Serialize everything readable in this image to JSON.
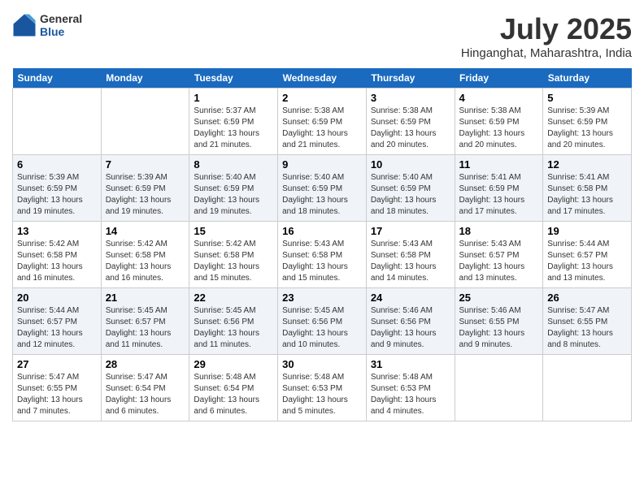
{
  "header": {
    "logo": {
      "general": "General",
      "blue": "Blue"
    },
    "title": "July 2025",
    "location": "Hinganghat, Maharashtra, India"
  },
  "calendar": {
    "headers": [
      "Sunday",
      "Monday",
      "Tuesday",
      "Wednesday",
      "Thursday",
      "Friday",
      "Saturday"
    ],
    "weeks": [
      [
        {
          "day": "",
          "info": ""
        },
        {
          "day": "",
          "info": ""
        },
        {
          "day": "1",
          "info": "Sunrise: 5:37 AM\nSunset: 6:59 PM\nDaylight: 13 hours and 21 minutes."
        },
        {
          "day": "2",
          "info": "Sunrise: 5:38 AM\nSunset: 6:59 PM\nDaylight: 13 hours and 21 minutes."
        },
        {
          "day": "3",
          "info": "Sunrise: 5:38 AM\nSunset: 6:59 PM\nDaylight: 13 hours and 20 minutes."
        },
        {
          "day": "4",
          "info": "Sunrise: 5:38 AM\nSunset: 6:59 PM\nDaylight: 13 hours and 20 minutes."
        },
        {
          "day": "5",
          "info": "Sunrise: 5:39 AM\nSunset: 6:59 PM\nDaylight: 13 hours and 20 minutes."
        }
      ],
      [
        {
          "day": "6",
          "info": "Sunrise: 5:39 AM\nSunset: 6:59 PM\nDaylight: 13 hours and 19 minutes."
        },
        {
          "day": "7",
          "info": "Sunrise: 5:39 AM\nSunset: 6:59 PM\nDaylight: 13 hours and 19 minutes."
        },
        {
          "day": "8",
          "info": "Sunrise: 5:40 AM\nSunset: 6:59 PM\nDaylight: 13 hours and 19 minutes."
        },
        {
          "day": "9",
          "info": "Sunrise: 5:40 AM\nSunset: 6:59 PM\nDaylight: 13 hours and 18 minutes."
        },
        {
          "day": "10",
          "info": "Sunrise: 5:40 AM\nSunset: 6:59 PM\nDaylight: 13 hours and 18 minutes."
        },
        {
          "day": "11",
          "info": "Sunrise: 5:41 AM\nSunset: 6:59 PM\nDaylight: 13 hours and 17 minutes."
        },
        {
          "day": "12",
          "info": "Sunrise: 5:41 AM\nSunset: 6:58 PM\nDaylight: 13 hours and 17 minutes."
        }
      ],
      [
        {
          "day": "13",
          "info": "Sunrise: 5:42 AM\nSunset: 6:58 PM\nDaylight: 13 hours and 16 minutes."
        },
        {
          "day": "14",
          "info": "Sunrise: 5:42 AM\nSunset: 6:58 PM\nDaylight: 13 hours and 16 minutes."
        },
        {
          "day": "15",
          "info": "Sunrise: 5:42 AM\nSunset: 6:58 PM\nDaylight: 13 hours and 15 minutes."
        },
        {
          "day": "16",
          "info": "Sunrise: 5:43 AM\nSunset: 6:58 PM\nDaylight: 13 hours and 15 minutes."
        },
        {
          "day": "17",
          "info": "Sunrise: 5:43 AM\nSunset: 6:58 PM\nDaylight: 13 hours and 14 minutes."
        },
        {
          "day": "18",
          "info": "Sunrise: 5:43 AM\nSunset: 6:57 PM\nDaylight: 13 hours and 13 minutes."
        },
        {
          "day": "19",
          "info": "Sunrise: 5:44 AM\nSunset: 6:57 PM\nDaylight: 13 hours and 13 minutes."
        }
      ],
      [
        {
          "day": "20",
          "info": "Sunrise: 5:44 AM\nSunset: 6:57 PM\nDaylight: 13 hours and 12 minutes."
        },
        {
          "day": "21",
          "info": "Sunrise: 5:45 AM\nSunset: 6:57 PM\nDaylight: 13 hours and 11 minutes."
        },
        {
          "day": "22",
          "info": "Sunrise: 5:45 AM\nSunset: 6:56 PM\nDaylight: 13 hours and 11 minutes."
        },
        {
          "day": "23",
          "info": "Sunrise: 5:45 AM\nSunset: 6:56 PM\nDaylight: 13 hours and 10 minutes."
        },
        {
          "day": "24",
          "info": "Sunrise: 5:46 AM\nSunset: 6:56 PM\nDaylight: 13 hours and 9 minutes."
        },
        {
          "day": "25",
          "info": "Sunrise: 5:46 AM\nSunset: 6:55 PM\nDaylight: 13 hours and 9 minutes."
        },
        {
          "day": "26",
          "info": "Sunrise: 5:47 AM\nSunset: 6:55 PM\nDaylight: 13 hours and 8 minutes."
        }
      ],
      [
        {
          "day": "27",
          "info": "Sunrise: 5:47 AM\nSunset: 6:55 PM\nDaylight: 13 hours and 7 minutes."
        },
        {
          "day": "28",
          "info": "Sunrise: 5:47 AM\nSunset: 6:54 PM\nDaylight: 13 hours and 6 minutes."
        },
        {
          "day": "29",
          "info": "Sunrise: 5:48 AM\nSunset: 6:54 PM\nDaylight: 13 hours and 6 minutes."
        },
        {
          "day": "30",
          "info": "Sunrise: 5:48 AM\nSunset: 6:53 PM\nDaylight: 13 hours and 5 minutes."
        },
        {
          "day": "31",
          "info": "Sunrise: 5:48 AM\nSunset: 6:53 PM\nDaylight: 13 hours and 4 minutes."
        },
        {
          "day": "",
          "info": ""
        },
        {
          "day": "",
          "info": ""
        }
      ]
    ]
  }
}
